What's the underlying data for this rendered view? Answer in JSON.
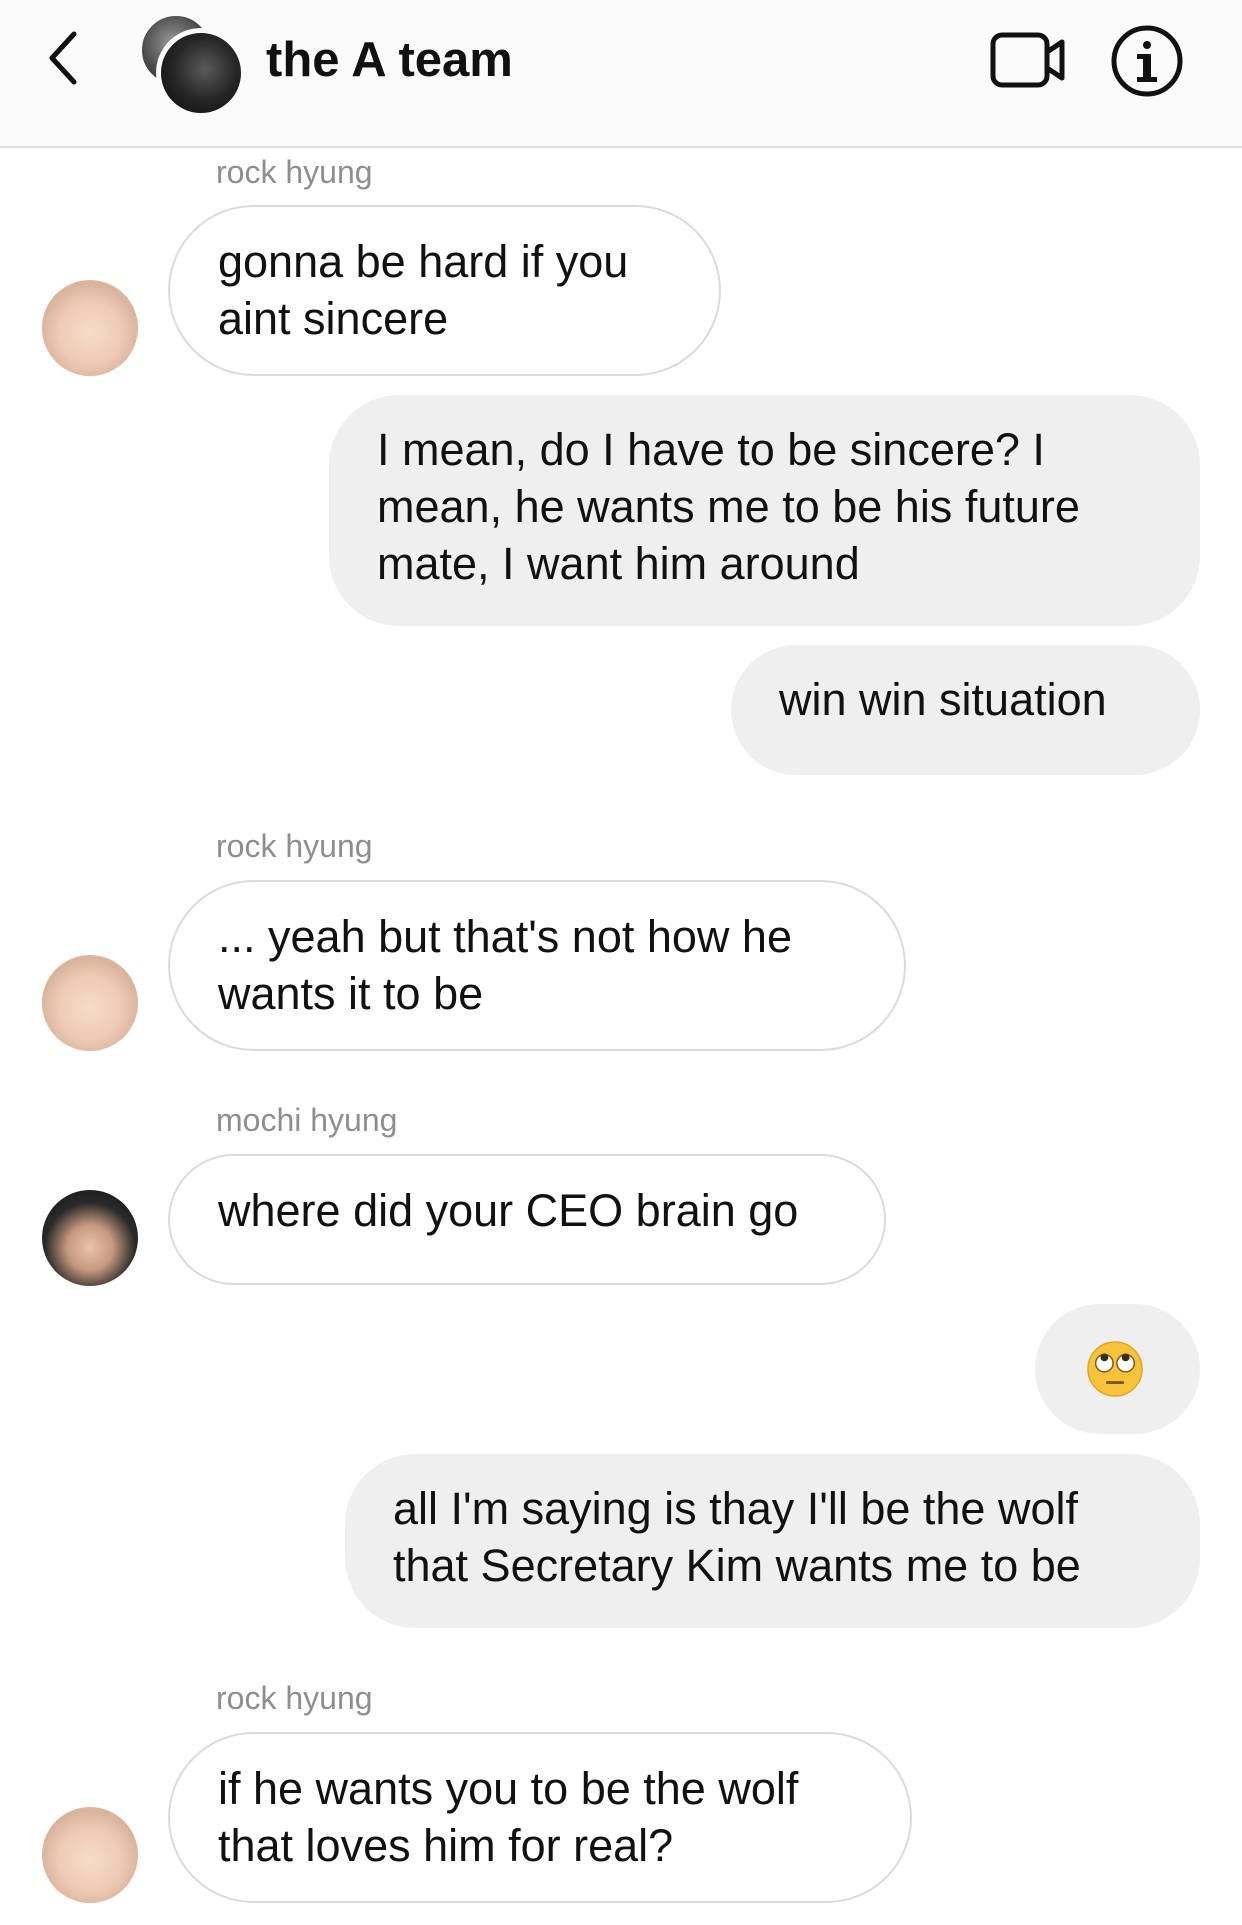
{
  "header": {
    "title": "the A team",
    "back_icon": "chevron-left-icon",
    "video_icon": "video-camera-icon",
    "info_icon": "info-icon"
  },
  "messages": [
    {
      "sender": "rock hyung",
      "text_lines": [
        "gonna be hard if you",
        "aint sincere"
      ],
      "direction": "incoming"
    },
    {
      "text_lines": [
        "I mean, do I have to be sincere? I",
        "mean, he wants me to be his future",
        "mate, I want him around"
      ],
      "direction": "outgoing"
    },
    {
      "text_lines": [
        "win win situation"
      ],
      "direction": "outgoing"
    },
    {
      "sender": "rock hyung",
      "text_lines": [
        "... yeah but that's not how he",
        "wants it to be"
      ],
      "direction": "incoming"
    },
    {
      "sender": "mochi hyung",
      "text_lines": [
        "where did your CEO brain go"
      ],
      "direction": "incoming"
    },
    {
      "emoji": "face-with-rolling-eyes",
      "direction": "outgoing"
    },
    {
      "text_lines": [
        "all I'm saying is thay I'll be the wolf",
        "that Secretary Kim wants me to be"
      ],
      "direction": "outgoing"
    },
    {
      "sender": "rock hyung",
      "text_lines": [
        "if he wants you to be the wolf",
        "that loves him for real?"
      ],
      "direction": "incoming"
    }
  ],
  "colors": {
    "incoming_bubble_border": "#dbdbdb",
    "outgoing_bubble_bg": "#efefef",
    "sender_label": "#8e8e8e",
    "header_bg": "#fafafa"
  }
}
